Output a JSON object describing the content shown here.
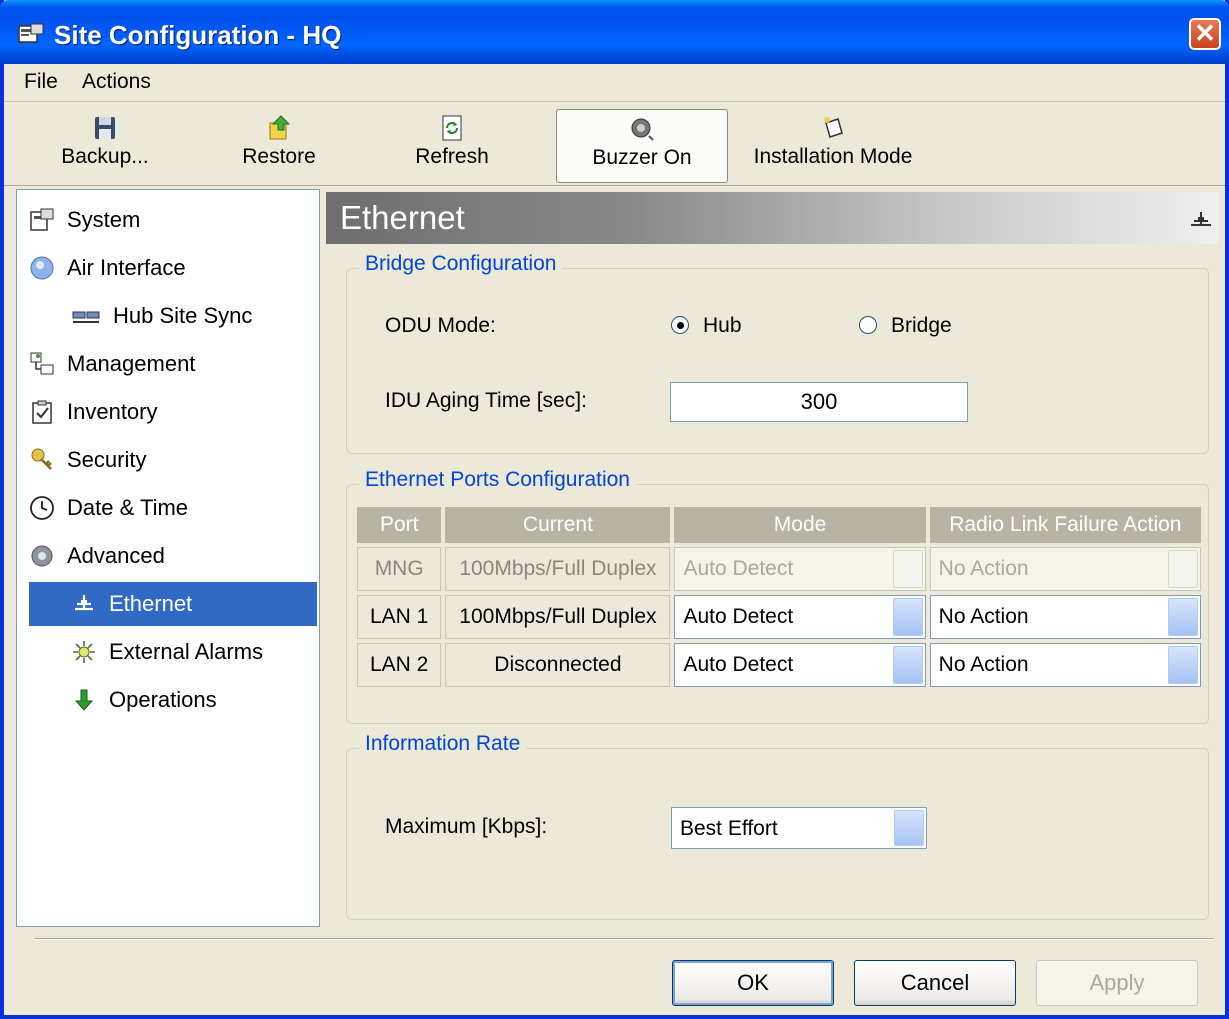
{
  "window": {
    "title": "Site Configuration - HQ",
    "close_glyph": "✕"
  },
  "menu": {
    "file": "File",
    "actions": "Actions"
  },
  "toolbar": {
    "backup": "Backup...",
    "restore": "Restore",
    "refresh": "Refresh",
    "buzzer": "Buzzer On",
    "installation": "Installation Mode"
  },
  "sidebar": {
    "items": [
      {
        "label": "System",
        "icon": "system-icon"
      },
      {
        "label": "Air Interface",
        "icon": "air-interface-icon"
      },
      {
        "label": "Hub Site Sync",
        "icon": "hub-site-sync-icon"
      },
      {
        "label": "Management",
        "icon": "management-icon"
      },
      {
        "label": "Inventory",
        "icon": "inventory-icon"
      },
      {
        "label": "Security",
        "icon": "security-icon"
      },
      {
        "label": "Date & Time",
        "icon": "clock-icon"
      },
      {
        "label": "Advanced",
        "icon": "gear-icon"
      },
      {
        "label": "Ethernet",
        "icon": "ethernet-icon",
        "selected": true
      },
      {
        "label": "External Alarms",
        "icon": "alarm-icon"
      },
      {
        "label": "Operations",
        "icon": "operations-icon"
      }
    ]
  },
  "panel": {
    "title": "Ethernet",
    "bridge": {
      "legend": "Bridge Configuration",
      "odu_label": "ODU Mode:",
      "hub_label": "Hub",
      "bridge_label": "Bridge",
      "selected_mode": "Hub",
      "aging_label": "IDU Aging Time [sec]:",
      "aging_value": "300"
    },
    "ports": {
      "legend": "Ethernet Ports Configuration",
      "headers": [
        "Port",
        "Current",
        "Mode",
        "Radio Link Failure Action"
      ],
      "rows": [
        {
          "port": "MNG",
          "current": "100Mbps/Full Duplex",
          "mode": "Auto Detect",
          "action": "No Action",
          "disabled": true
        },
        {
          "port": "LAN 1",
          "current": "100Mbps/Full Duplex",
          "mode": "Auto Detect",
          "action": "No Action",
          "disabled": false
        },
        {
          "port": "LAN 2",
          "current": "Disconnected",
          "mode": "Auto Detect",
          "action": "No Action",
          "disabled": false
        }
      ]
    },
    "rate": {
      "legend": "Information Rate",
      "max_label": "Maximum [Kbps]:",
      "max_value": "Best Effort"
    }
  },
  "buttons": {
    "ok": "OK",
    "cancel": "Cancel",
    "apply": "Apply"
  },
  "colors": {
    "accent": "#316ac5",
    "legend": "#0046d5",
    "titlebar": "#0058ee"
  }
}
